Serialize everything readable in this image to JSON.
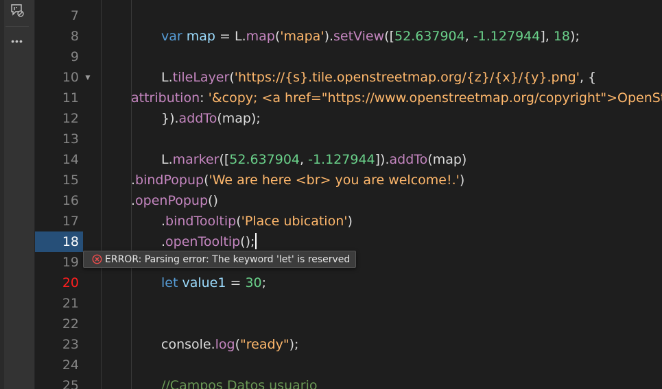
{
  "activity_bar": {
    "icons": [
      {
        "name": "comment-check-icon"
      },
      {
        "name": "more-icon",
        "glyph": "•••"
      }
    ]
  },
  "editor": {
    "active_line": "18",
    "error_line": "20",
    "lines": [
      {
        "num": "7",
        "tokens": []
      },
      {
        "num": "8",
        "tokens": [
          {
            "t": "var",
            "c": "kw"
          },
          {
            "t": " ",
            "c": "plain"
          },
          {
            "t": "map",
            "c": "var"
          },
          {
            "t": " = ",
            "c": "plain"
          },
          {
            "t": "L",
            "c": "plain"
          },
          {
            "t": ".",
            "c": "plain"
          },
          {
            "t": "map",
            "c": "fn"
          },
          {
            "t": "(",
            "c": "plain"
          },
          {
            "t": "'mapa'",
            "c": "str"
          },
          {
            "t": ").",
            "c": "plain"
          },
          {
            "t": "setView",
            "c": "fn"
          },
          {
            "t": "([",
            "c": "plain"
          },
          {
            "t": "52.637904",
            "c": "num"
          },
          {
            "t": ", ",
            "c": "plain"
          },
          {
            "t": "-1.127944",
            "c": "num"
          },
          {
            "t": "], ",
            "c": "plain"
          },
          {
            "t": "18",
            "c": "num"
          },
          {
            "t": ");",
            "c": "plain"
          }
        ]
      },
      {
        "num": "9",
        "tokens": []
      },
      {
        "num": "10",
        "fold": "▼",
        "tokens": [
          {
            "t": "L",
            "c": "plain"
          },
          {
            "t": ".",
            "c": "plain"
          },
          {
            "t": "tileLayer",
            "c": "fn"
          },
          {
            "t": "(",
            "c": "plain"
          },
          {
            "t": "'https://{s}.tile.openstreetmap.org/{z}/{x}/{y}.png'",
            "c": "str"
          },
          {
            "t": ", {",
            "c": "plain"
          }
        ]
      },
      {
        "num": "11",
        "indent": "half",
        "tokens": [
          {
            "t": "attribution",
            "c": "prop"
          },
          {
            "t": ": ",
            "c": "plain"
          },
          {
            "t": "'&copy; <a href=\"https://www.openstreetmap.org/copyright\">OpenStreetMap</a> contributors'",
            "c": "str"
          }
        ]
      },
      {
        "num": "12",
        "tokens": [
          {
            "t": "}).",
            "c": "plain"
          },
          {
            "t": "addTo",
            "c": "fn"
          },
          {
            "t": "(",
            "c": "plain"
          },
          {
            "t": "map",
            "c": "plain"
          },
          {
            "t": ");",
            "c": "plain"
          }
        ]
      },
      {
        "num": "13",
        "tokens": []
      },
      {
        "num": "14",
        "tokens": [
          {
            "t": "L",
            "c": "plain"
          },
          {
            "t": ".",
            "c": "plain"
          },
          {
            "t": "marker",
            "c": "fn"
          },
          {
            "t": "([",
            "c": "plain"
          },
          {
            "t": "52.637904",
            "c": "num"
          },
          {
            "t": ", ",
            "c": "plain"
          },
          {
            "t": "-1.127944",
            "c": "num"
          },
          {
            "t": "]).",
            "c": "plain"
          },
          {
            "t": "addTo",
            "c": "fn"
          },
          {
            "t": "(",
            "c": "plain"
          },
          {
            "t": "map",
            "c": "plain"
          },
          {
            "t": ")",
            "c": "plain"
          }
        ]
      },
      {
        "num": "15",
        "indent": "half",
        "tokens": [
          {
            "t": ".",
            "c": "plain"
          },
          {
            "t": "bindPopup",
            "c": "fn"
          },
          {
            "t": "(",
            "c": "plain"
          },
          {
            "t": "'We are here <br> you are welcome!.'",
            "c": "str"
          },
          {
            "t": ")",
            "c": "plain"
          }
        ]
      },
      {
        "num": "16",
        "indent": "half",
        "tokens": [
          {
            "t": ".",
            "c": "plain"
          },
          {
            "t": "openPopup",
            "c": "fn"
          },
          {
            "t": "()",
            "c": "plain"
          }
        ]
      },
      {
        "num": "17",
        "tokens": [
          {
            "t": ".",
            "c": "plain"
          },
          {
            "t": "bindTooltip",
            "c": "fn"
          },
          {
            "t": "(",
            "c": "plain"
          },
          {
            "t": "'Place ubication'",
            "c": "str"
          },
          {
            "t": ")",
            "c": "plain"
          }
        ]
      },
      {
        "num": "18",
        "cursor": true,
        "tokens": [
          {
            "t": ".",
            "c": "plain"
          },
          {
            "t": "openTooltip",
            "c": "fn"
          },
          {
            "t": "();",
            "c": "plain"
          }
        ]
      },
      {
        "num": "19",
        "tokens": []
      },
      {
        "num": "20",
        "tokens": [
          {
            "t": "let",
            "c": "kw"
          },
          {
            "t": " ",
            "c": "plain"
          },
          {
            "t": "value1",
            "c": "var"
          },
          {
            "t": " = ",
            "c": "plain"
          },
          {
            "t": "30",
            "c": "num"
          },
          {
            "t": ";",
            "c": "plain"
          }
        ]
      },
      {
        "num": "21",
        "tokens": []
      },
      {
        "num": "22",
        "tokens": []
      },
      {
        "num": "23",
        "tokens": [
          {
            "t": "console",
            "c": "plain"
          },
          {
            "t": ".",
            "c": "plain"
          },
          {
            "t": "log",
            "c": "fn"
          },
          {
            "t": "(",
            "c": "plain"
          },
          {
            "t": "\"ready\"",
            "c": "str"
          },
          {
            "t": ");",
            "c": "plain"
          }
        ]
      },
      {
        "num": "24",
        "tokens": []
      },
      {
        "num": "25",
        "tokens": [
          {
            "t": "//Campos Datos usuario",
            "c": "cmt"
          }
        ]
      }
    ]
  },
  "error_tooltip": {
    "message": "ERROR: Parsing error: The keyword 'let' is reserved"
  },
  "colors": {
    "background": "#1e1e1e",
    "active_line": "#264f78",
    "error_line_number": "#ff1e1e",
    "error_icon": "#f14c4c"
  }
}
